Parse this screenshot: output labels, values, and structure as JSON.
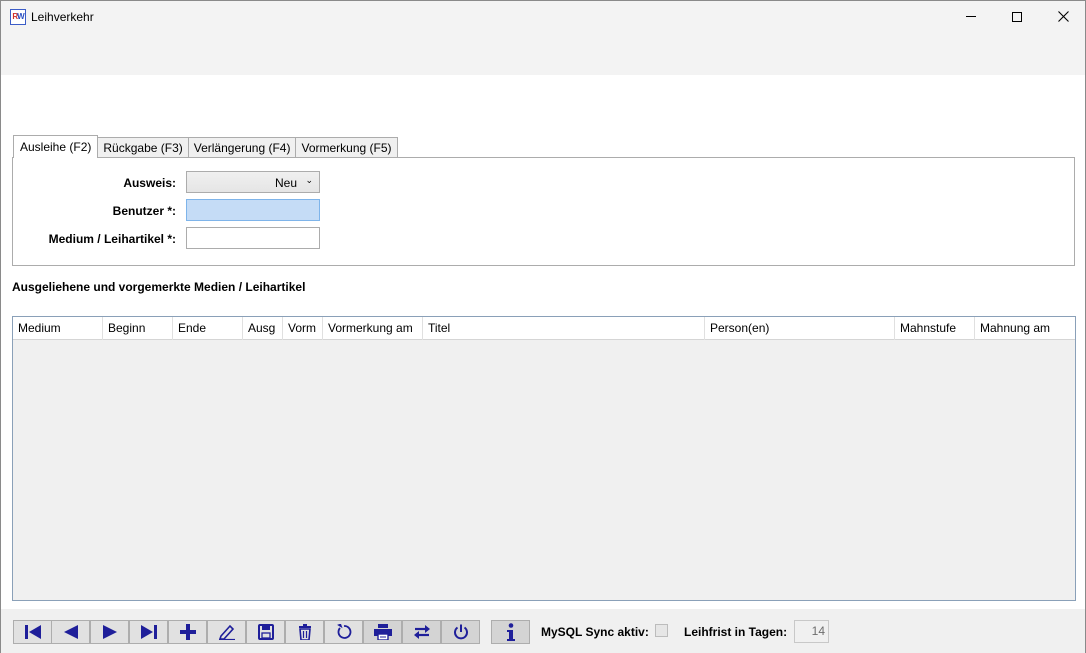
{
  "window": {
    "title": "Leihverkehr",
    "icon_letters_a": "R",
    "icon_letters_b": "W"
  },
  "tabs": [
    {
      "label": "Ausleihe (F2)"
    },
    {
      "label": "Rückgabe (F3)"
    },
    {
      "label": "Verlängerung (F4)"
    },
    {
      "label": "Vormerkung (F5)"
    }
  ],
  "form": {
    "ausweis_label": "Ausweis:",
    "ausweis_value": "Neu",
    "benutzer_label": "Benutzer *:",
    "benutzer_value": "",
    "medium_label": "Medium / Leihartikel *:",
    "medium_value": ""
  },
  "section_title": "Ausgeliehene und vorgemerkte Medien / Leihartikel",
  "grid": {
    "columns": [
      "Medium",
      "Beginn",
      "Ende",
      "Ausg",
      "Vorm",
      "Vormerkung am",
      "Titel",
      "Person(en)",
      "Mahnstufe",
      "Mahnung am"
    ],
    "rows": []
  },
  "toolbar": {
    "buttons": [
      "first-icon",
      "previous-icon",
      "next-icon",
      "last-icon",
      "add-icon",
      "edit-icon",
      "save-icon",
      "delete-icon",
      "refresh-icon",
      "print-icon",
      "swap-icon",
      "power-icon",
      "info-icon"
    ],
    "mysql_label": "MySQL Sync aktiv:",
    "mysql_checked": false,
    "leihfrist_label": "Leihfrist in Tagen:",
    "leihfrist_value": "14"
  },
  "colors": {
    "icon_blue": "#1f1f9a",
    "selected_input": "#c5dcf6"
  }
}
